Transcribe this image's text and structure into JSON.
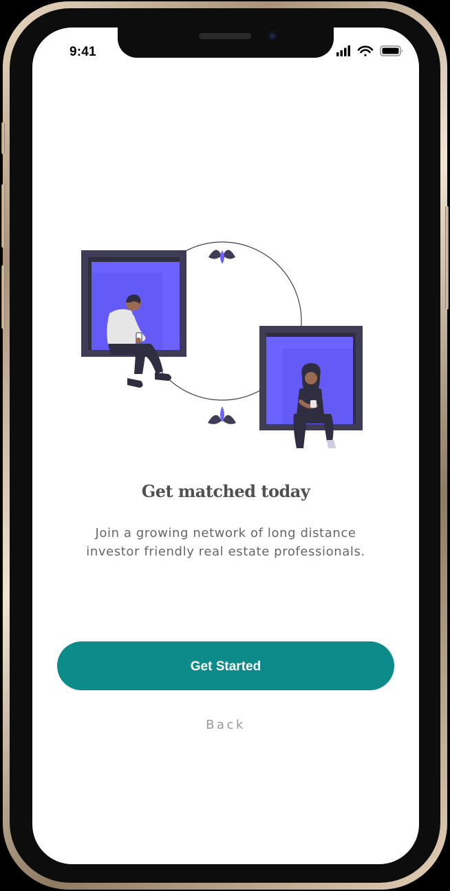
{
  "status_bar": {
    "time": "9:41",
    "signal_icon": "cellular-signal-icon",
    "wifi_icon": "wifi-icon",
    "battery_icon": "battery-icon"
  },
  "onboarding": {
    "illustration": "two-people-in-window-frames-illustration",
    "title": "Get matched today",
    "description": "Join a growing network of long distance investor friendly real estate professionals.",
    "primary_button_label": "Get Started",
    "back_label": "Back"
  },
  "colors": {
    "primary": "#0c8b8a",
    "illustration_accent": "#6c63ff",
    "illustration_dark": "#3f3d56",
    "title_text": "#505050",
    "body_text": "#666666",
    "muted_text": "#9a9a9a"
  }
}
